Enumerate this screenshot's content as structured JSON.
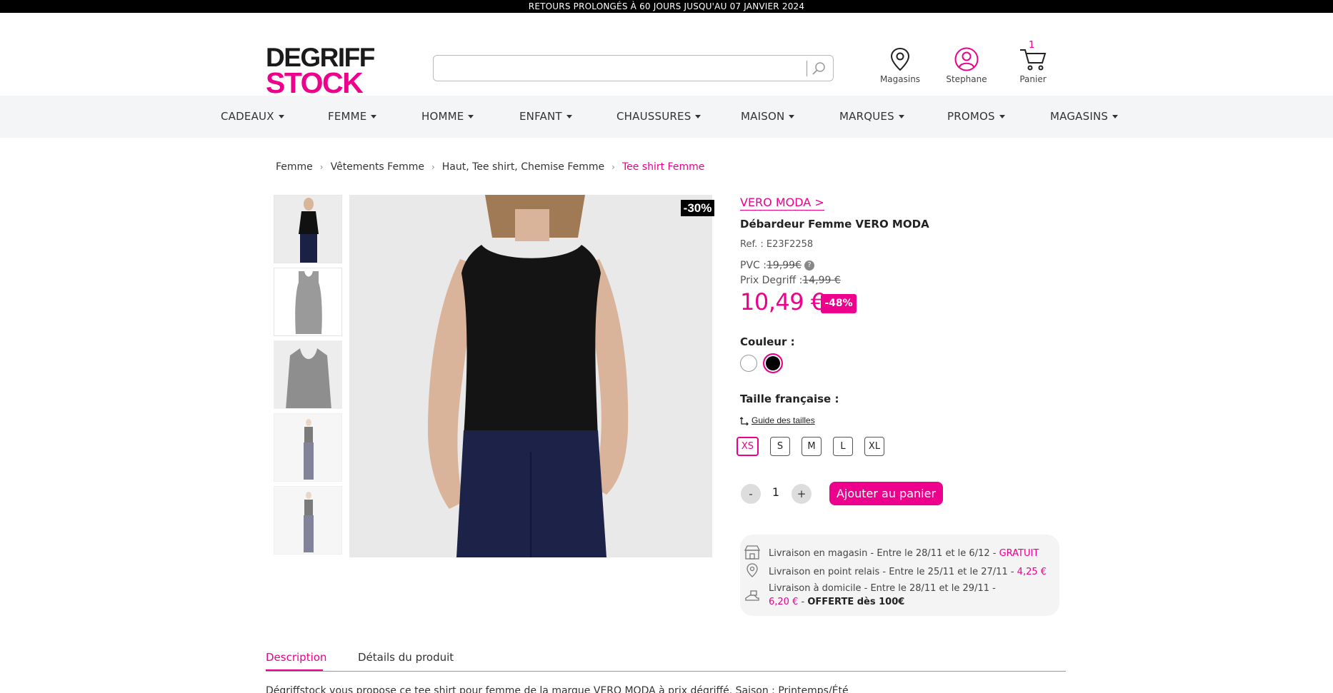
{
  "promo_bar": "RETOURS PROLONGÉS À 60 JOURS JUSQU'AU 07 JANVIER 2024",
  "header": {
    "logo_line1": "DEGRIFF",
    "logo_line2": "STOCK",
    "search_placeholder": "",
    "stores_label": "Magasins",
    "user_label": "Stephane",
    "cart_label": "Panier",
    "cart_count": "1"
  },
  "nav": [
    "CADEAUX",
    "FEMME",
    "HOMME",
    "ENFANT",
    "CHAUSSURES",
    "MAISON",
    "MARQUES",
    "PROMOS",
    "MAGASINS"
  ],
  "breadcrumb": [
    "Femme",
    "Vêtements Femme",
    "Haut, Tee shirt, Chemise Femme",
    "Tee shirt Femme"
  ],
  "gallery": {
    "badge": "-30%"
  },
  "product": {
    "brand": "VERO MODA >",
    "title": "Débardeur Femme VERO MODA",
    "ref": "Ref. : E23F2258",
    "pvc_label": "PVC :",
    "pvc_price": "19,99€",
    "pvc_help": "?",
    "degriff_label": "Prix Degriff :",
    "degriff_price": "14,99 €",
    "price": "10,49 €",
    "discount": "-48%",
    "color_label": "Couleur :",
    "colors": [
      "#ffffff",
      "#000000"
    ],
    "selected_color": "#000000",
    "size_label": "Taille française :",
    "size_guide": "Guide des tailles",
    "sizes": [
      "XS",
      "S",
      "M",
      "L",
      "XL"
    ],
    "selected_size": "XS",
    "qty_minus": "-",
    "qty": "1",
    "qty_plus": "+",
    "add_to_cart": "Ajouter au panier"
  },
  "delivery": {
    "store": {
      "text": "Livraison en magasin - Entre le 28/11 et le 6/12 - ",
      "price": "GRATUIT"
    },
    "relay": {
      "text": "Livraison en point relais - Entre le 25/11 et le 27/11 - ",
      "price": "4,25 €"
    },
    "home": {
      "text": "Livraison à domicile - Entre le 28/11 et le 29/11 -",
      "price": "6,20 €",
      "sep": " - ",
      "offer": "OFFERTE dès 100€"
    }
  },
  "tabs": {
    "description": "Description",
    "details": "Détails du produit"
  },
  "description_text": "Dégriffstock vous propose ce tee shirt pour femme de la marque VERO MODA à prix dégriffé. Saison : Printemps/Été",
  "colors": {
    "accent": "#ec008c",
    "promo_bg": "#000000",
    "nav_bg": "#f4f5f6"
  }
}
